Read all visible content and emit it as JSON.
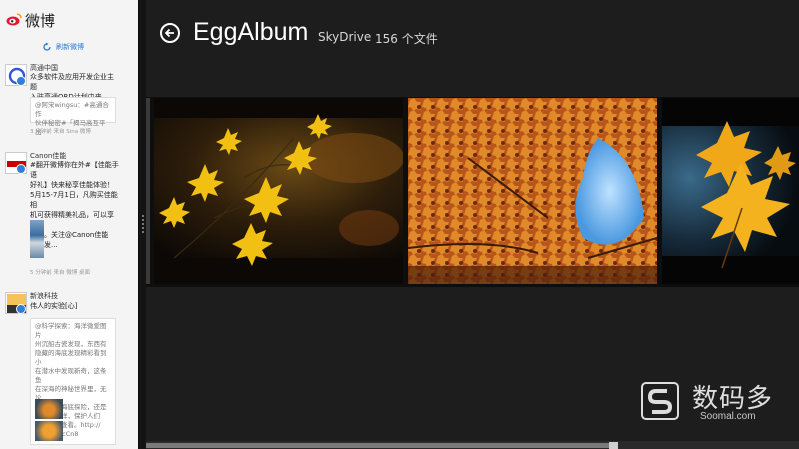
{
  "weibo": {
    "title": "微博",
    "refresh_label": "刷新微博",
    "posts": [
      {
        "name": "高通中国",
        "text": "众多软件及应用开发企业主题\n入驻高通QRD计划中来。[围]",
        "repost": "@阿宋wingsu：#高通合作\n伙伴秘密#「揭马高互平出",
        "meta": "3 分钟前 来自 Sina 微博"
      },
      {
        "name": "Canon佳能",
        "text": "#翻开微博你在外#【佳能手语\n好礼】快来秘享佳能体验！\n5月15-7月1日，凡购买佳能相\n机可获得精美礼品，可以享受大\n礼包。关注@Canon佳能\n并转发...",
        "meta": "5 分钟前 来自 微博 桌面"
      },
      {
        "name": "新浪科技",
        "text": "伟人的实验[心]",
        "repost": "@科学探索：海洋微爱图片\n州沉船古瓷发现，东西有\n隐藏的海底发现精彩看到小\n在潜水中发现新奇，这条鱼\n在深海的神秘世界里，无论\n是奇妙的海底探险，还是\n浪漫的海洋，保护人们\n允许跟踪查看。http://\nt.cn/z0QcCn8",
        "meta": ""
      }
    ]
  },
  "album": {
    "back_label": "back",
    "title": "EggAlbum",
    "source": "SkyDrive",
    "count": "156 个文件"
  },
  "watermark": {
    "cn": "数码多",
    "en": "Soomal.com"
  },
  "colors": {
    "sidebar_bg": "#f4f4f4",
    "app_bg": "#1d1d1d",
    "weibo_blue": "#2b7bd6",
    "accent": "#1a5e8c"
  }
}
